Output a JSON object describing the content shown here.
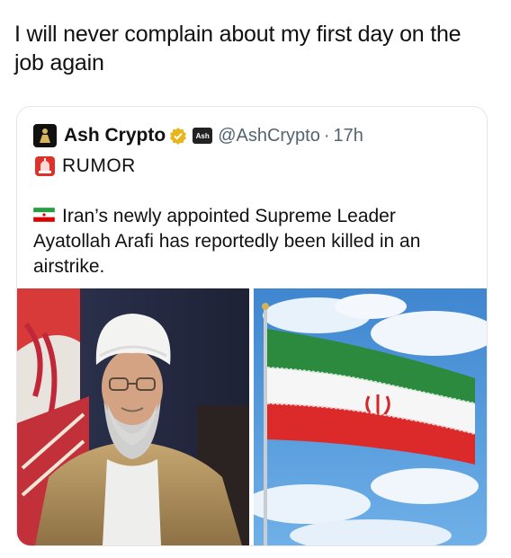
{
  "post": {
    "caption": "I will never complain about my first day on the job again"
  },
  "tweet": {
    "author_name": "Ash Crypto",
    "affiliate_badge_text": "Ash",
    "handle": "@AshCrypto",
    "separator": "·",
    "time": "17h",
    "tag_label": "RUMOR",
    "body": "Iran’s newly appointed Supreme Leader Ayatollah Arafi has reportedly been killed in an airstrike.",
    "images": [
      {
        "name": "cleric-portrait"
      },
      {
        "name": "iran-flag-photo"
      }
    ]
  },
  "colors": {
    "verified_gold": "#e8b51a",
    "handle_gray": "#536471",
    "flag_green": "#239f40",
    "flag_red": "#da0000",
    "sky_blue": "#4f95d8"
  },
  "icons": [
    "robed-figure-avatar-icon",
    "verified-badge-icon",
    "affiliate-badge-icon",
    "siren-icon",
    "iran-flag-icon"
  ]
}
